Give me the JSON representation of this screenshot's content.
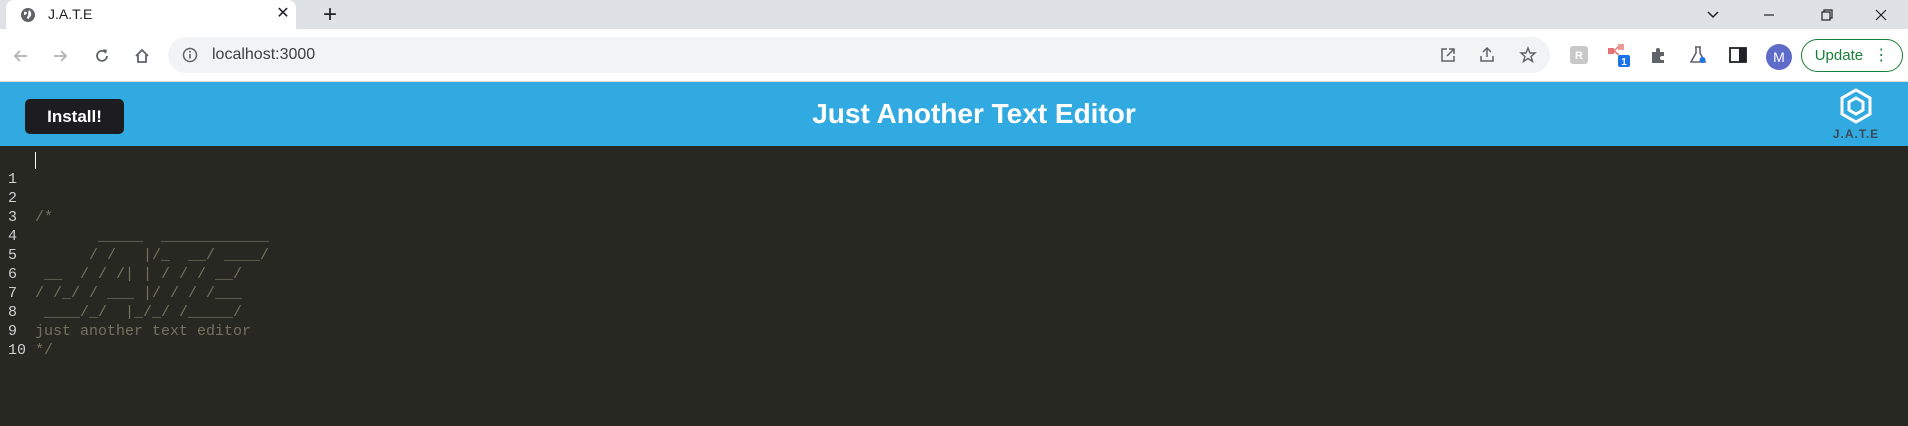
{
  "browser": {
    "tab_title": "J.A.T.E",
    "url": "localhost:3000",
    "update_label": "Update",
    "avatar_letter": "M",
    "extension_badge": "1"
  },
  "app": {
    "title": "Just Another Text Editor",
    "install_label": "Install!",
    "logo_text": "J.A.T.E",
    "header_color": "#31a9e1"
  },
  "editor": {
    "lines": [
      {
        "num": "1",
        "text": ""
      },
      {
        "num": "2",
        "text": "/*"
      },
      {
        "num": "3",
        "text": "       _____  ____________"
      },
      {
        "num": "4",
        "text": "      / /   |/_  __/ ____/"
      },
      {
        "num": "5",
        "text": " __  / / /| | / / / __/"
      },
      {
        "num": "6",
        "text": "/ /_/ / ___ |/ / / /___"
      },
      {
        "num": "7",
        "text": " ____/_/  |_/_/ /_____/"
      },
      {
        "num": "8",
        "text": "just another text editor"
      },
      {
        "num": "9",
        "text": "*/"
      },
      {
        "num": "10",
        "text": ""
      }
    ]
  }
}
